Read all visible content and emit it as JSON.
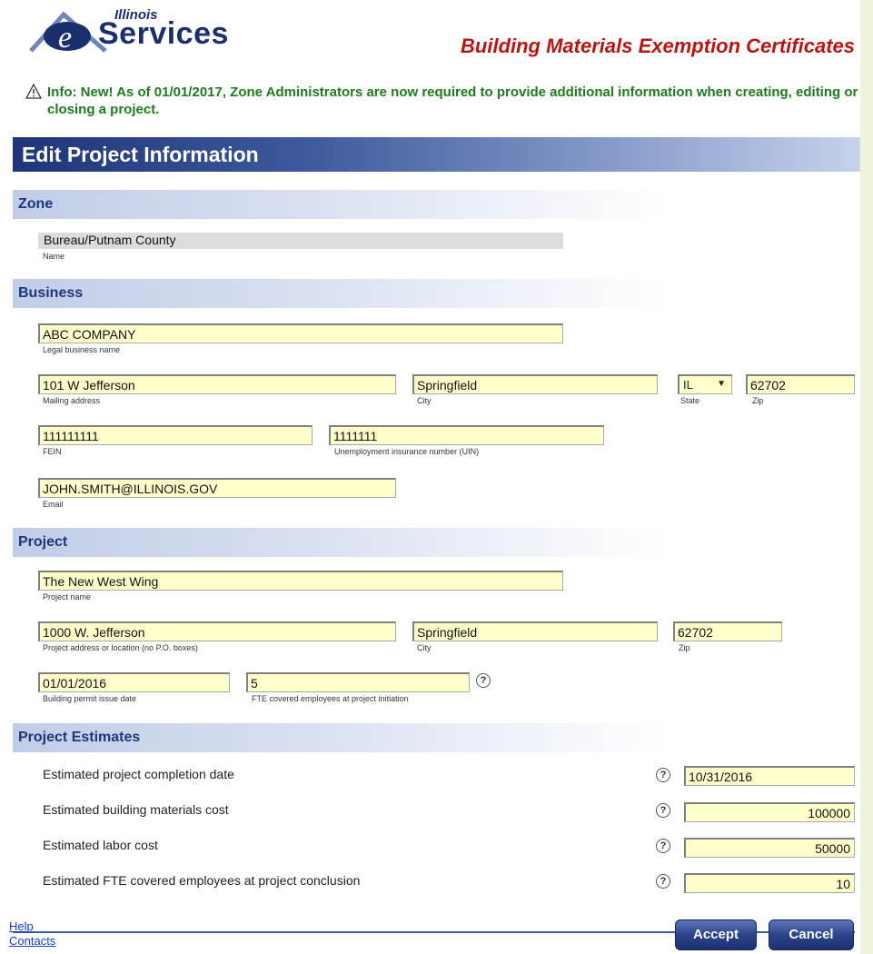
{
  "header": {
    "logo_top": "Illinois",
    "logo_main": "Services",
    "app_title": "Building Materials Exemption Certificates"
  },
  "info": {
    "text": "Info: New! As of 01/01/2017, Zone Administrators are now required to provide additional information when creating, editing or closing a project."
  },
  "page_title": "Edit Project Information",
  "zone": {
    "section_label": "Zone",
    "name_value": "Bureau/Putnam County",
    "name_caption": "Name"
  },
  "business": {
    "section_label": "Business",
    "legal_name": {
      "value": "ABC COMPANY",
      "caption": "Legal business name"
    },
    "mailing_address": {
      "value": "101 W Jefferson",
      "caption": "Mailing address"
    },
    "city": {
      "value": "Springfield",
      "caption": "City"
    },
    "state": {
      "value": "IL",
      "caption": "State"
    },
    "zip": {
      "value": "62702",
      "caption": "Zip"
    },
    "fein": {
      "value": "111111111",
      "caption": "FEIN"
    },
    "uin": {
      "value": "1111111",
      "caption": "Unemployment insurance number (UIN)"
    },
    "email": {
      "value": "JOHN.SMITH@ILLINOIS.GOV",
      "caption": "Email"
    }
  },
  "project": {
    "section_label": "Project",
    "name": {
      "value": "The New West Wing",
      "caption": "Project name"
    },
    "address": {
      "value": "1000 W. Jefferson",
      "caption": "Project address or location (no P.O. boxes)"
    },
    "city": {
      "value": "Springfield",
      "caption": "City"
    },
    "zip": {
      "value": "62702",
      "caption": "Zip"
    },
    "permit_date": {
      "value": "01/01/2016",
      "caption": "Building permit issue date"
    },
    "fte_initial": {
      "value": "5",
      "caption": "FTE covered employees at project initiation"
    }
  },
  "estimates": {
    "section_label": "Project Estimates",
    "rows": [
      {
        "label": "Estimated project completion date",
        "value": "10/31/2016"
      },
      {
        "label": "Estimated building materials cost",
        "value": "100000"
      },
      {
        "label": "Estimated labor cost",
        "value": "50000"
      },
      {
        "label": "Estimated FTE covered employees at project conclusion",
        "value": "10"
      }
    ]
  },
  "help_glyph": "?",
  "footer": {
    "help_link": "Help",
    "contacts_link": "Contacts",
    "accept_label": "Accept",
    "cancel_label": "Cancel"
  },
  "colors": {
    "accent": "#1f3577",
    "title_red": "#b81414",
    "info_green": "#1f7a1f",
    "field_bg": "#ffffcc"
  },
  "icons": {
    "logo": "illinois-eservices-logo",
    "info": "warning-triangle-icon",
    "help": "question-circle-icon",
    "dropdown": "chevron-down-icon"
  }
}
